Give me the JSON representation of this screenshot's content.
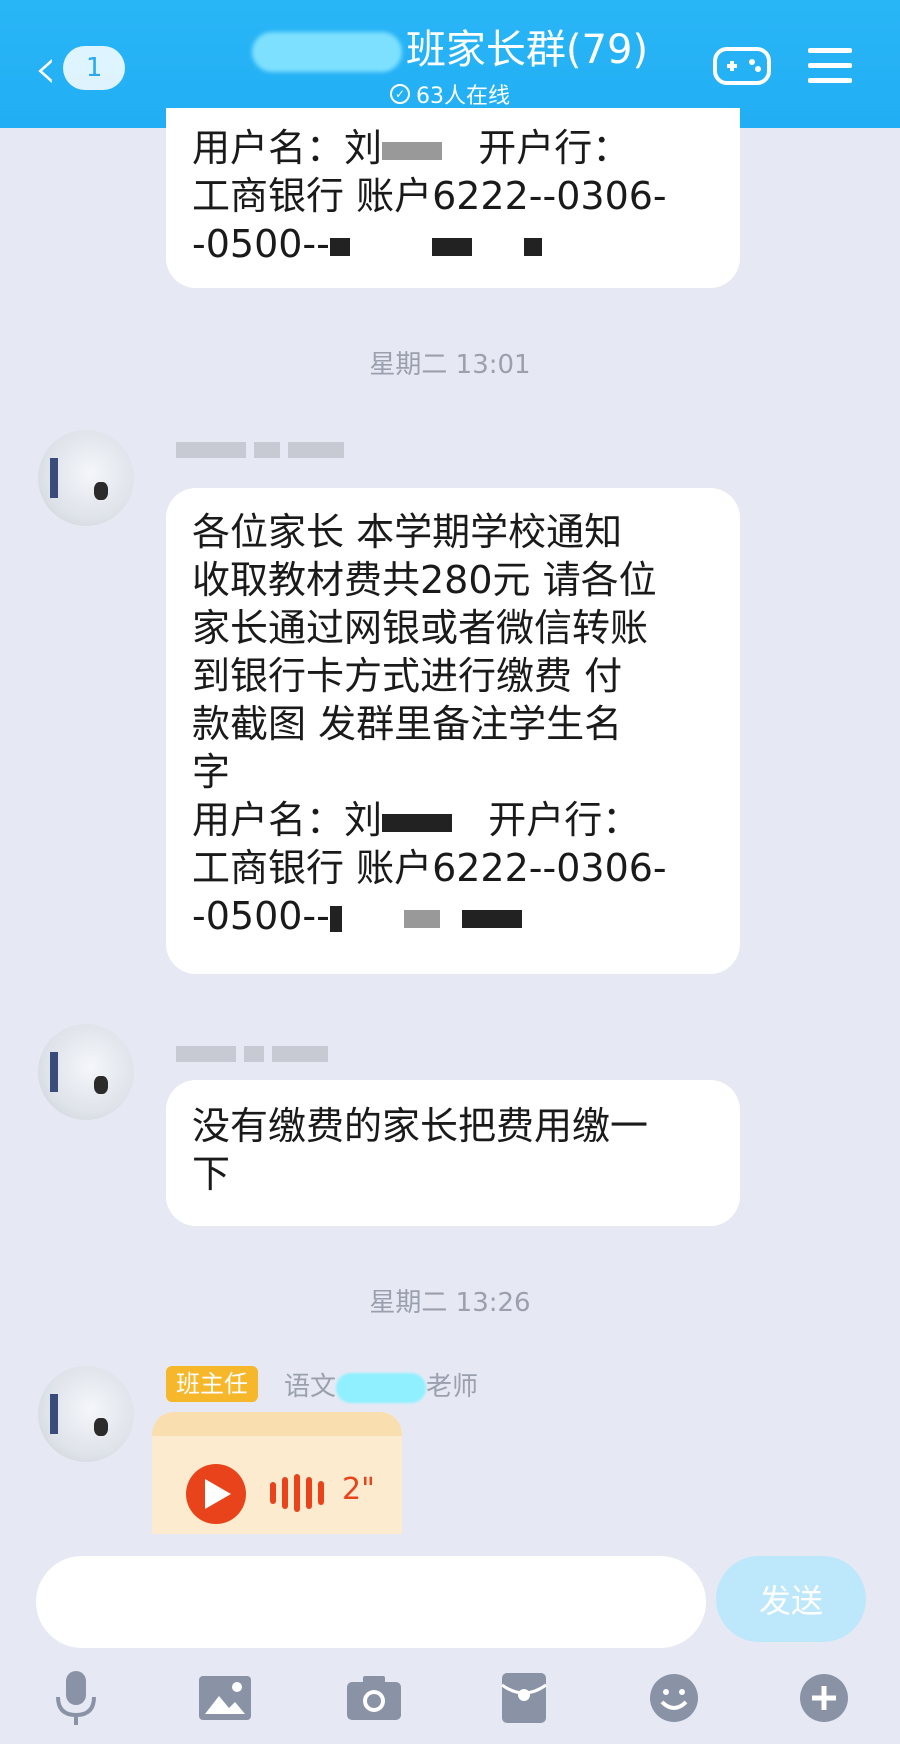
{
  "header": {
    "back_badge": "1",
    "title": "班家长群(79)",
    "online": "63人在线"
  },
  "messages": {
    "top_bubble": {
      "lines": [
        "用户名：刘",
        "开户行：",
        "工商银行   账户6222--0306-",
        "-0500--"
      ]
    },
    "time1": "星期二 13:01",
    "notice": {
      "lines": [
        "各位家长 本学期学校通知",
        "收取教材费共280元 请各位",
        "家长通过网银或者微信转账",
        "到银行卡方式进行缴费 付",
        "款截图 发群里备注学生名",
        "字",
        "用户名：刘",
        "开户行：",
        "工商银行   账户6222--0306-",
        "-0500--"
      ]
    },
    "followup": {
      "lines": [
        "没有缴费的家长把费用缴一",
        "下"
      ]
    },
    "time2": "星期二 13:26",
    "teacher": {
      "tag": "班主任",
      "name_part1": "语文",
      "name_part2": "老师",
      "voice_duration": "2\""
    }
  },
  "composer": {
    "send_label": "发送"
  },
  "toolbar_icons": [
    "mic-icon",
    "image-icon",
    "camera-icon",
    "red-packet-icon",
    "emoji-icon",
    "plus-icon"
  ]
}
